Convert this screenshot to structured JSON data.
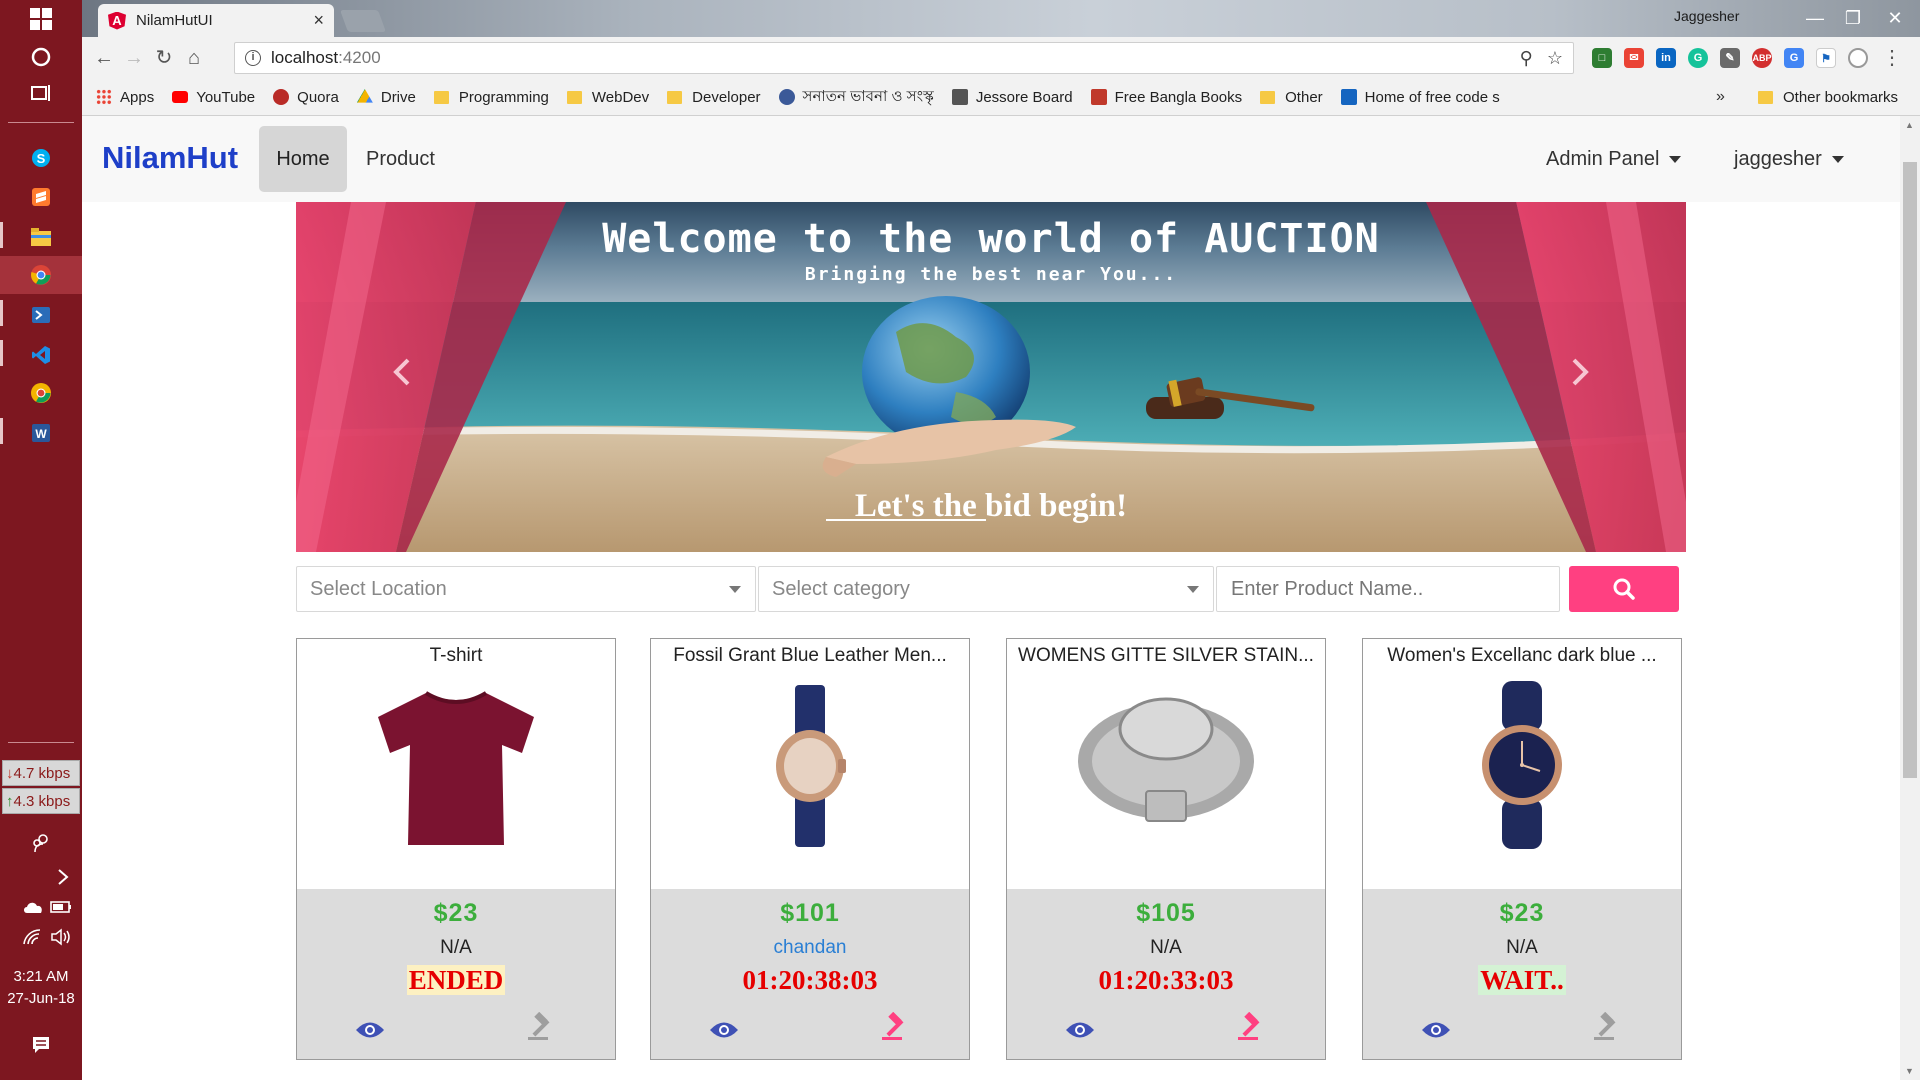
{
  "browser": {
    "tab_title": "NilamHutUI",
    "tab_logo": "A",
    "url_host": "localhost",
    "url_port": ":4200",
    "window_user": "Jaggesher",
    "bookmarks": [
      {
        "label": "Apps",
        "icon": "apps-grid-icon"
      },
      {
        "label": "YouTube",
        "icon": "youtube-icon"
      },
      {
        "label": "Quora",
        "icon": "quora-icon"
      },
      {
        "label": "Drive",
        "icon": "drive-icon"
      },
      {
        "label": "Programming",
        "icon": "folder-icon"
      },
      {
        "label": "WebDev",
        "icon": "folder-icon"
      },
      {
        "label": "Developer",
        "icon": "folder-icon"
      },
      {
        "label": "সনাতন ভাবনা ও সংস্কৃ",
        "icon": "site-icon"
      },
      {
        "label": "Jessore Board",
        "icon": "site-icon"
      },
      {
        "label": "Free Bangla Books",
        "icon": "book-icon"
      },
      {
        "label": "Other",
        "icon": "folder-icon"
      },
      {
        "label": "Home of free code s",
        "icon": "code-icon"
      }
    ],
    "more_bookmarks": "»",
    "other_bookmarks": "Other bookmarks"
  },
  "taskbar": {
    "download_speed": "4.7 kbps",
    "upload_speed": "4.3 kbps",
    "time": "3:21 AM",
    "date": "27-Jun-18"
  },
  "navbar": {
    "brand": "NilamHut",
    "home": "Home",
    "product": "Product",
    "admin": "Admin Panel",
    "user": "jaggesher"
  },
  "banner": {
    "title": "Welcome to the world of AUCTION",
    "subtitle": "Bringing the best near You...",
    "tagline": "Let's the bid begin!"
  },
  "search": {
    "location_placeholder": "Select Location",
    "category_placeholder": "Select category",
    "product_placeholder": "Enter Product Name.."
  },
  "products": [
    {
      "name": "T-shirt",
      "price": "$23",
      "bidder": "N/A",
      "status": "ENDED",
      "bid_enabled": false
    },
    {
      "name": "Fossil Grant Blue Leather Men...",
      "price": "$101",
      "bidder": "chandan",
      "status": "01:20:38:03",
      "bid_enabled": true
    },
    {
      "name": "WOMENS GITTE SILVER STAIN...",
      "price": "$105",
      "bidder": "N/A",
      "status": "01:20:33:03",
      "bid_enabled": true
    },
    {
      "name": "Women's Excellanc dark blue ...",
      "price": "$23",
      "bidder": "N/A",
      "status": "WAIT..",
      "bid_enabled": false
    }
  ],
  "colors": {
    "brand": "#1e3fc8",
    "accent": "#ff4081",
    "price": "#3cae3c",
    "status": "#e60000",
    "icon_active": "#3f51b5"
  }
}
